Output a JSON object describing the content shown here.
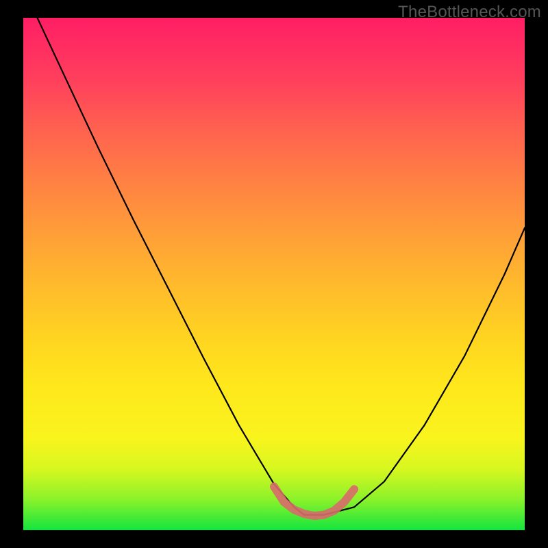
{
  "watermark": "TheBottleneck.com",
  "chart_data": {
    "type": "line",
    "title": "",
    "xlabel": "",
    "ylabel": "",
    "xlim": [
      0,
      1
    ],
    "ylim": [
      0,
      1
    ],
    "series": [
      {
        "name": "curve",
        "color": "#000000",
        "x": [
          0.028,
          0.09,
          0.15,
          0.22,
          0.29,
          0.36,
          0.43,
          0.5,
          0.54,
          0.56,
          0.6,
          0.66,
          0.72,
          0.8,
          0.88,
          0.96,
          1.0
        ],
        "y": [
          1.0,
          0.87,
          0.745,
          0.605,
          0.47,
          0.335,
          0.205,
          0.09,
          0.045,
          0.03,
          0.03,
          0.045,
          0.095,
          0.205,
          0.34,
          0.5,
          0.59
        ]
      },
      {
        "name": "bottom-highlight",
        "color": "#d86a6c",
        "x": [
          0.5,
          0.52,
          0.54,
          0.56,
          0.58,
          0.6,
          0.62,
          0.64,
          0.66
        ],
        "y": [
          0.085,
          0.055,
          0.04,
          0.032,
          0.028,
          0.03,
          0.038,
          0.055,
          0.08
        ]
      }
    ],
    "gradient_stops": [
      {
        "pos": 0.0,
        "color": "#14e53f"
      },
      {
        "pos": 0.06,
        "color": "#8bf22a"
      },
      {
        "pos": 0.12,
        "color": "#d8f720"
      },
      {
        "pos": 0.18,
        "color": "#f9f41e"
      },
      {
        "pos": 0.28,
        "color": "#ffe81c"
      },
      {
        "pos": 0.38,
        "color": "#ffd321"
      },
      {
        "pos": 0.48,
        "color": "#ffba2c"
      },
      {
        "pos": 0.58,
        "color": "#ff9e38"
      },
      {
        "pos": 0.68,
        "color": "#ff8143"
      },
      {
        "pos": 0.78,
        "color": "#ff624f"
      },
      {
        "pos": 0.88,
        "color": "#ff3f5d"
      },
      {
        "pos": 1.0,
        "color": "#ff1e65"
      }
    ]
  }
}
